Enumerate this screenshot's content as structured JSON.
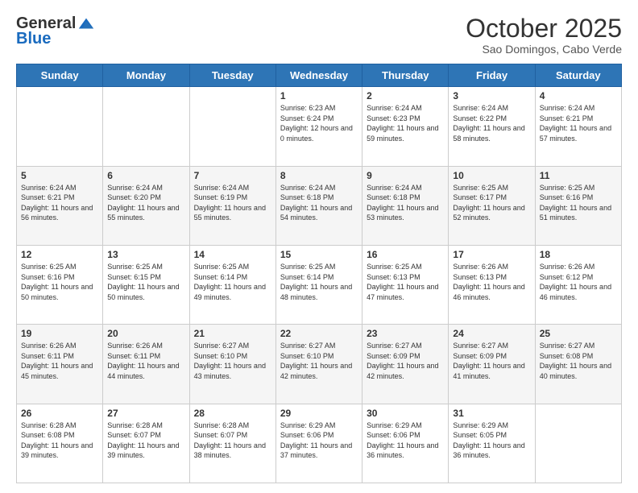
{
  "header": {
    "logo_general": "General",
    "logo_blue": "Blue",
    "month_title": "October 2025",
    "location": "Sao Domingos, Cabo Verde"
  },
  "days_of_week": [
    "Sunday",
    "Monday",
    "Tuesday",
    "Wednesday",
    "Thursday",
    "Friday",
    "Saturday"
  ],
  "weeks": [
    [
      {
        "day": "",
        "info": ""
      },
      {
        "day": "",
        "info": ""
      },
      {
        "day": "",
        "info": ""
      },
      {
        "day": "1",
        "info": "Sunrise: 6:23 AM\nSunset: 6:24 PM\nDaylight: 12 hours and 0 minutes."
      },
      {
        "day": "2",
        "info": "Sunrise: 6:24 AM\nSunset: 6:23 PM\nDaylight: 11 hours and 59 minutes."
      },
      {
        "day": "3",
        "info": "Sunrise: 6:24 AM\nSunset: 6:22 PM\nDaylight: 11 hours and 58 minutes."
      },
      {
        "day": "4",
        "info": "Sunrise: 6:24 AM\nSunset: 6:21 PM\nDaylight: 11 hours and 57 minutes."
      }
    ],
    [
      {
        "day": "5",
        "info": "Sunrise: 6:24 AM\nSunset: 6:21 PM\nDaylight: 11 hours and 56 minutes."
      },
      {
        "day": "6",
        "info": "Sunrise: 6:24 AM\nSunset: 6:20 PM\nDaylight: 11 hours and 55 minutes."
      },
      {
        "day": "7",
        "info": "Sunrise: 6:24 AM\nSunset: 6:19 PM\nDaylight: 11 hours and 55 minutes."
      },
      {
        "day": "8",
        "info": "Sunrise: 6:24 AM\nSunset: 6:18 PM\nDaylight: 11 hours and 54 minutes."
      },
      {
        "day": "9",
        "info": "Sunrise: 6:24 AM\nSunset: 6:18 PM\nDaylight: 11 hours and 53 minutes."
      },
      {
        "day": "10",
        "info": "Sunrise: 6:25 AM\nSunset: 6:17 PM\nDaylight: 11 hours and 52 minutes."
      },
      {
        "day": "11",
        "info": "Sunrise: 6:25 AM\nSunset: 6:16 PM\nDaylight: 11 hours and 51 minutes."
      }
    ],
    [
      {
        "day": "12",
        "info": "Sunrise: 6:25 AM\nSunset: 6:16 PM\nDaylight: 11 hours and 50 minutes."
      },
      {
        "day": "13",
        "info": "Sunrise: 6:25 AM\nSunset: 6:15 PM\nDaylight: 11 hours and 50 minutes."
      },
      {
        "day": "14",
        "info": "Sunrise: 6:25 AM\nSunset: 6:14 PM\nDaylight: 11 hours and 49 minutes."
      },
      {
        "day": "15",
        "info": "Sunrise: 6:25 AM\nSunset: 6:14 PM\nDaylight: 11 hours and 48 minutes."
      },
      {
        "day": "16",
        "info": "Sunrise: 6:25 AM\nSunset: 6:13 PM\nDaylight: 11 hours and 47 minutes."
      },
      {
        "day": "17",
        "info": "Sunrise: 6:26 AM\nSunset: 6:13 PM\nDaylight: 11 hours and 46 minutes."
      },
      {
        "day": "18",
        "info": "Sunrise: 6:26 AM\nSunset: 6:12 PM\nDaylight: 11 hours and 46 minutes."
      }
    ],
    [
      {
        "day": "19",
        "info": "Sunrise: 6:26 AM\nSunset: 6:11 PM\nDaylight: 11 hours and 45 minutes."
      },
      {
        "day": "20",
        "info": "Sunrise: 6:26 AM\nSunset: 6:11 PM\nDaylight: 11 hours and 44 minutes."
      },
      {
        "day": "21",
        "info": "Sunrise: 6:27 AM\nSunset: 6:10 PM\nDaylight: 11 hours and 43 minutes."
      },
      {
        "day": "22",
        "info": "Sunrise: 6:27 AM\nSunset: 6:10 PM\nDaylight: 11 hours and 42 minutes."
      },
      {
        "day": "23",
        "info": "Sunrise: 6:27 AM\nSunset: 6:09 PM\nDaylight: 11 hours and 42 minutes."
      },
      {
        "day": "24",
        "info": "Sunrise: 6:27 AM\nSunset: 6:09 PM\nDaylight: 11 hours and 41 minutes."
      },
      {
        "day": "25",
        "info": "Sunrise: 6:27 AM\nSunset: 6:08 PM\nDaylight: 11 hours and 40 minutes."
      }
    ],
    [
      {
        "day": "26",
        "info": "Sunrise: 6:28 AM\nSunset: 6:08 PM\nDaylight: 11 hours and 39 minutes."
      },
      {
        "day": "27",
        "info": "Sunrise: 6:28 AM\nSunset: 6:07 PM\nDaylight: 11 hours and 39 minutes."
      },
      {
        "day": "28",
        "info": "Sunrise: 6:28 AM\nSunset: 6:07 PM\nDaylight: 11 hours and 38 minutes."
      },
      {
        "day": "29",
        "info": "Sunrise: 6:29 AM\nSunset: 6:06 PM\nDaylight: 11 hours and 37 minutes."
      },
      {
        "day": "30",
        "info": "Sunrise: 6:29 AM\nSunset: 6:06 PM\nDaylight: 11 hours and 36 minutes."
      },
      {
        "day": "31",
        "info": "Sunrise: 6:29 AM\nSunset: 6:05 PM\nDaylight: 11 hours and 36 minutes."
      },
      {
        "day": "",
        "info": ""
      }
    ]
  ]
}
